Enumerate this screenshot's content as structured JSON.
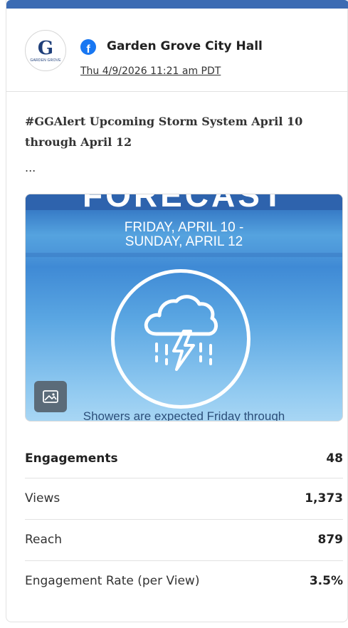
{
  "post": {
    "author": "Garden Grove City Hall",
    "timestamp": "Thu 4/9/2026 11:21 am PDT",
    "avatar_text": "G",
    "avatar_subtext": "GARDEN GROVE",
    "body": "#GGAlert Upcoming Storm System April 10 through April 12",
    "ellipsis": "...",
    "platform_icon": "facebook-icon"
  },
  "image": {
    "top_word": "FORECAST",
    "line1": "FRIDAY, APRIL 10 -",
    "line2": "SUNDAY, APRIL 12",
    "caption": "Showers are expected Friday through",
    "badge_icon": "image-icon"
  },
  "metrics": [
    {
      "label": "Engagements",
      "value": "48"
    },
    {
      "label": "Views",
      "value": "1,373"
    },
    {
      "label": "Reach",
      "value": "879"
    },
    {
      "label": "Engagement Rate (per View)",
      "value": "3.5%"
    }
  ],
  "colors": {
    "accent_bar": "#3b6bb3",
    "facebook": "#1877f2"
  }
}
